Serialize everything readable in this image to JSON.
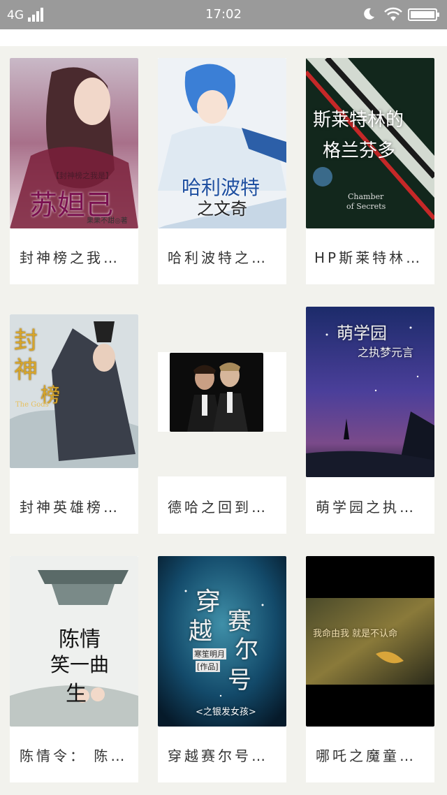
{
  "status_bar": {
    "network": "4G",
    "time": "17:02"
  },
  "books": [
    {
      "title": "封神榜之我…",
      "cover_text": [
        "【封神榜之我是】",
        "苏妲己",
        "果果不甜◎著"
      ]
    },
    {
      "title": "哈利波特之…",
      "cover_text": [
        "哈利波特",
        "之文奇"
      ]
    },
    {
      "title": "HP斯莱特林…",
      "cover_text": [
        "斯莱特林的",
        "格兰芬多",
        "Chamber",
        "of Secrets"
      ]
    },
    {
      "title": "封神英雄榜…",
      "cover_text": [
        "封",
        "神",
        "榜",
        "The Gods"
      ]
    },
    {
      "title": "德哈之回到…",
      "cover_text": []
    },
    {
      "title": "萌学园之执…",
      "cover_text": [
        "萌学园",
        "之执梦元言"
      ]
    },
    {
      "title": "陈情令： 陈…",
      "cover_text": [
        "陈情",
        "笑一曲",
        "生"
      ]
    },
    {
      "title": "穿越赛尔号…",
      "cover_text": [
        "穿",
        "越",
        "赛",
        "尔",
        "号",
        "寒笙明月",
        "[作品]",
        "<之银发女孩>"
      ]
    },
    {
      "title": "哪吒之魔童…",
      "cover_text": [
        "我命由我 就是不认命"
      ]
    }
  ],
  "colors": {
    "background": "#f2f2ed",
    "status_bar": "#9a9a9a",
    "card": "#ffffff",
    "title_text": "#333333"
  }
}
